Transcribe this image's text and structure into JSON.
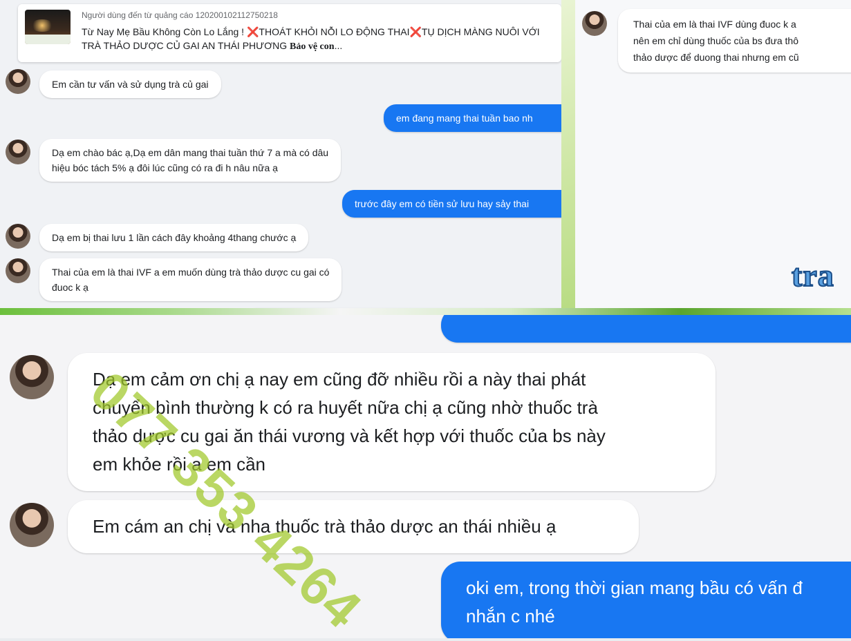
{
  "ad": {
    "source": "Người dùng đến từ quảng cáo 120200102112750218",
    "text_part1": "Từ Nay Mẹ Bầu Không Còn Lo Lắng ! ",
    "x_mark": "❌",
    "text_part2": "THOÁT KHỎI NỖI LO ĐỘNG THAI",
    "text_part3": "TỤ DỊCH MÀNG NUÔI VỚI TRÀ THẢO DƯỢC CỦ GAI AN THÁI PHƯƠNG ",
    "text_bold": "Bảo vệ con",
    "ellipsis": "..."
  },
  "top_left_messages": [
    {
      "type": "in",
      "text": "Em cần tư vấn và sử dụng trà củ gai"
    },
    {
      "type": "out",
      "text": "em đang mang thai tuần bao nh"
    },
    {
      "type": "in",
      "text": "Dạ em chào bác ạ,Dạ em dân mang thai tuần thứ 7 a mà có dâu\nhiệu bóc tách 5% ạ đôi lúc cũng có ra đi h nâu nữa ạ"
    },
    {
      "type": "out",
      "text": "trước đây em có tiền sử lưu hay sảy thai"
    },
    {
      "type": "in",
      "text": "Dạ em bị thai lưu 1 lần cách đây khoảng 4thang chước ạ"
    },
    {
      "type": "in",
      "text": "Thai của em là thai IVF a em muốn dùng trà thảo dược cu gai có\nđuoc k ạ"
    }
  ],
  "top_right": {
    "message": "Thai của em là thai IVF dùng đuoc k a\nnên em chỉ dùng thuốc của bs đưa thô\nthảo dược để duong thai nhưng em cũ",
    "product_word": "tra"
  },
  "bottom_messages": [
    {
      "type": "in",
      "text": "Dạ em cảm ơn chị ạ nay em cũng đỡ nhiều rồi a này thai phát\nchuyển bình thường k có ra huyết nữa chị ạ cũng nhờ thuốc trà\nthảo dược cu gai ăn thái vương và kết hợp với thuốc của bs này\nem khỏe rồi a em cần"
    },
    {
      "type": "in",
      "text": "Em cám an chị và nha thuốc trà thảo dược an thái nhiều ạ"
    },
    {
      "type": "out",
      "text": "oki em, trong thời gian mang bầu có vấn đ\nnhắn c nhé"
    }
  ],
  "watermark": "077 353 4264",
  "colors": {
    "outgoing": "#1877f2",
    "incoming": "#ffffff",
    "watermark": "#a0c828"
  }
}
